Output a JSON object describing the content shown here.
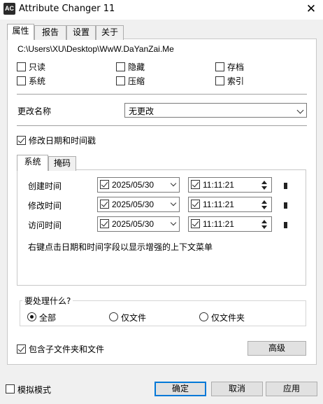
{
  "window": {
    "icon_text": "AC",
    "title": "Attribute Changer 11",
    "close_glyph": "✕"
  },
  "tabs": [
    "属性",
    "报告",
    "设置",
    "关于"
  ],
  "path": "C:\\Users\\XU\\Desktop\\WwW.DaYanZai.Me",
  "attributes": [
    {
      "label": "只读",
      "checked": false
    },
    {
      "label": "隐藏",
      "checked": false
    },
    {
      "label": "存档",
      "checked": false
    },
    {
      "label": "系统",
      "checked": false
    },
    {
      "label": "压缩",
      "checked": false
    },
    {
      "label": "索引",
      "checked": false
    }
  ],
  "rename": {
    "label": "更改名称",
    "value": "无更改"
  },
  "modify_dates": {
    "label": "修改日期和时间戳",
    "checked": true
  },
  "date_tabs": [
    "系统",
    "掩码"
  ],
  "date_rows": [
    {
      "label": "创建时间",
      "date": "2025/05/30",
      "time": "11:11:21"
    },
    {
      "label": "修改时间",
      "date": "2025/05/30",
      "time": "11:11:21"
    },
    {
      "label": "访问时间",
      "date": "2025/05/30",
      "time": "11:11:21"
    }
  ],
  "hint": "右键点击日期和时间字段以显示增强的上下文菜单",
  "process": {
    "title": "要处理什么?",
    "options": [
      {
        "label": "全部",
        "selected": true
      },
      {
        "label": "仅文件",
        "selected": false
      },
      {
        "label": "仅文件夹",
        "selected": false
      }
    ]
  },
  "include_sub": {
    "label": "包含子文件夹和文件",
    "checked": true
  },
  "advanced_label": "高级",
  "simulation": {
    "label": "模拟模式",
    "checked": false
  },
  "buttons": {
    "ok": "确定",
    "cancel": "取消",
    "apply": "应用"
  }
}
